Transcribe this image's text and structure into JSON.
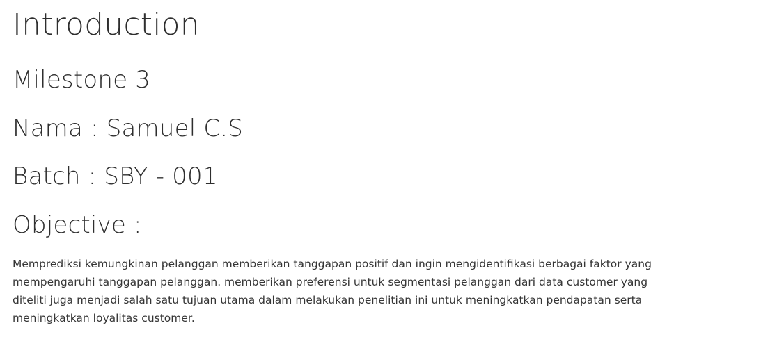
{
  "document": {
    "title": "Introduction",
    "milestone": "Milestone 3",
    "nama": "Nama : Samuel C.S",
    "batch": "Batch : SBY - 001",
    "objective_heading": "Objective :",
    "objective_text": "Memprediksi kemungkinan pelanggan memberikan tanggapan positif dan ingin mengidentifikasi berbagai faktor yang mempengaruhi tanggapan pelanggan. memberikan preferensi untuk segmentasi pelanggan dari data customer yang diteliti juga menjadi salah satu tujuan utama dalam melakukan penelitian ini untuk meningkatkan pendapatan serta meningkatkan loyalitas customer."
  }
}
